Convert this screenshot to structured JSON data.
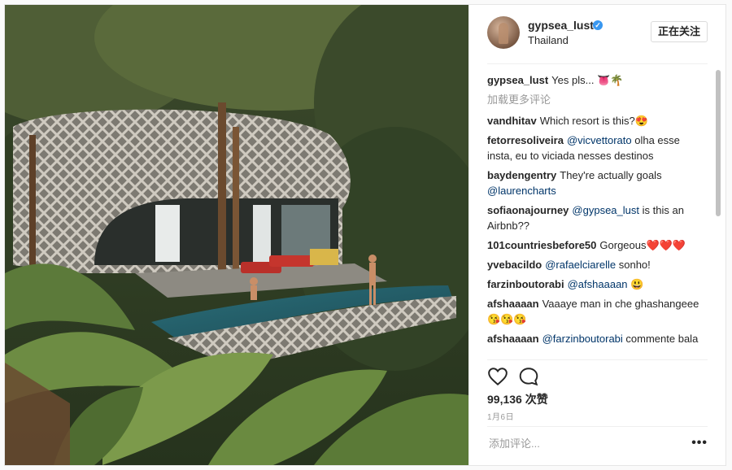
{
  "post": {
    "username": "gypsea_lust",
    "location": "Thailand",
    "follow_label": "正在关注",
    "load_more_label": "加载更多评论",
    "likes": "99,136 次赞",
    "date": "1月6日",
    "add_comment_placeholder": "添加评论...",
    "more_label": "•••"
  },
  "caption": {
    "user": "gypsea_lust",
    "text": "Yes pls... 👅🌴"
  },
  "comments": [
    {
      "user": "vandhitav",
      "text": "Which resort is this?😍"
    },
    {
      "user": "fetorresoliveira",
      "mention": "@vicvettorato",
      "text": "olha esse insta, eu to viciada nesses destinos"
    },
    {
      "user": "baydengentry",
      "text": "They're actually goals",
      "mention": "@laurencharts"
    },
    {
      "user": "sofiaonajourney",
      "mention": "@gypsea_lust",
      "text": "is this an Airbnb??"
    },
    {
      "user": "101countriesbefore50",
      "text": "Gorgeous",
      "hearts": "❤️❤️❤️"
    },
    {
      "user": "yvebacildo",
      "mention": "@rafaelciarelle",
      "text": "sonho!"
    },
    {
      "user": "farzinboutorabi",
      "mention": "@afshaaaan",
      "text": "😃"
    },
    {
      "user": "afshaaaan",
      "text": "Vaaaye man in che ghashangeee 😘😘😘"
    },
    {
      "user": "afshaaaan",
      "mention": "@farzinboutorabi",
      "text": "commente bala"
    }
  ],
  "icons": {
    "like": "heart-icon",
    "comment": "speech-bubble-icon",
    "verified": "verified-badge-icon",
    "more": "more-dots-icon"
  },
  "colors": {
    "link": "#003569",
    "verified": "#3897f0",
    "muted": "#999999"
  }
}
